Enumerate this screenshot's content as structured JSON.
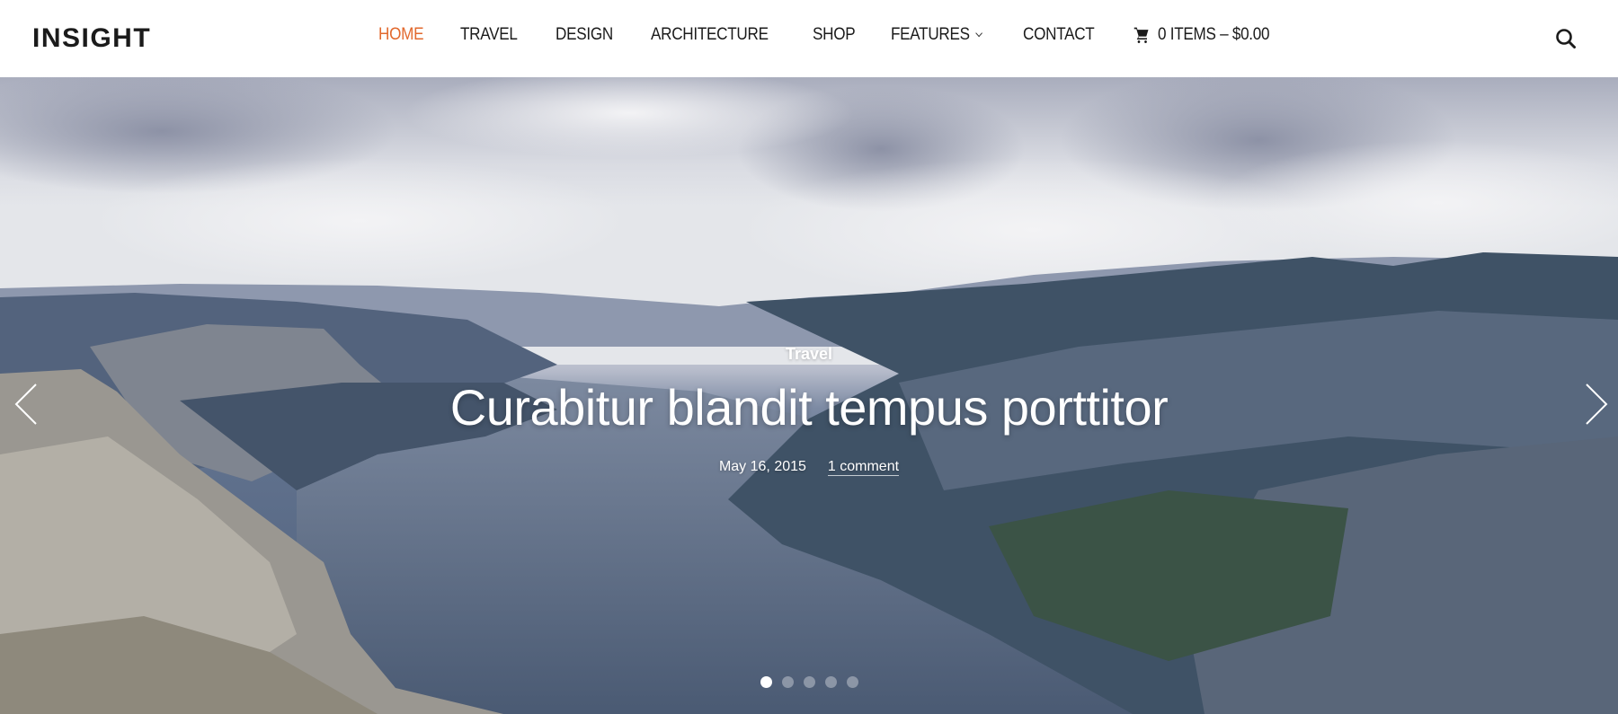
{
  "header": {
    "logo": "INSIGHT",
    "nav": [
      {
        "label": "HOME",
        "active": true
      },
      {
        "label": "TRAVEL"
      },
      {
        "label": "DESIGN"
      },
      {
        "label": "ARCHITECTURE"
      },
      {
        "label": "SHOP"
      },
      {
        "label": "FEATURES",
        "has_dropdown": true
      },
      {
        "label": "CONTACT"
      }
    ],
    "cart": {
      "icon": "cart-icon",
      "label": "0 ITEMS – $0.00"
    },
    "search_icon": "search-icon",
    "accent_color": "#e2692e"
  },
  "hero": {
    "category": "Travel",
    "title": "Curabitur blandit tempus porttitor",
    "date": "May 16, 2015",
    "comments": "1 comment",
    "prev_icon": "chevron-left-icon",
    "next_icon": "chevron-right-icon",
    "slides_total": 5,
    "slide_active": 1
  }
}
